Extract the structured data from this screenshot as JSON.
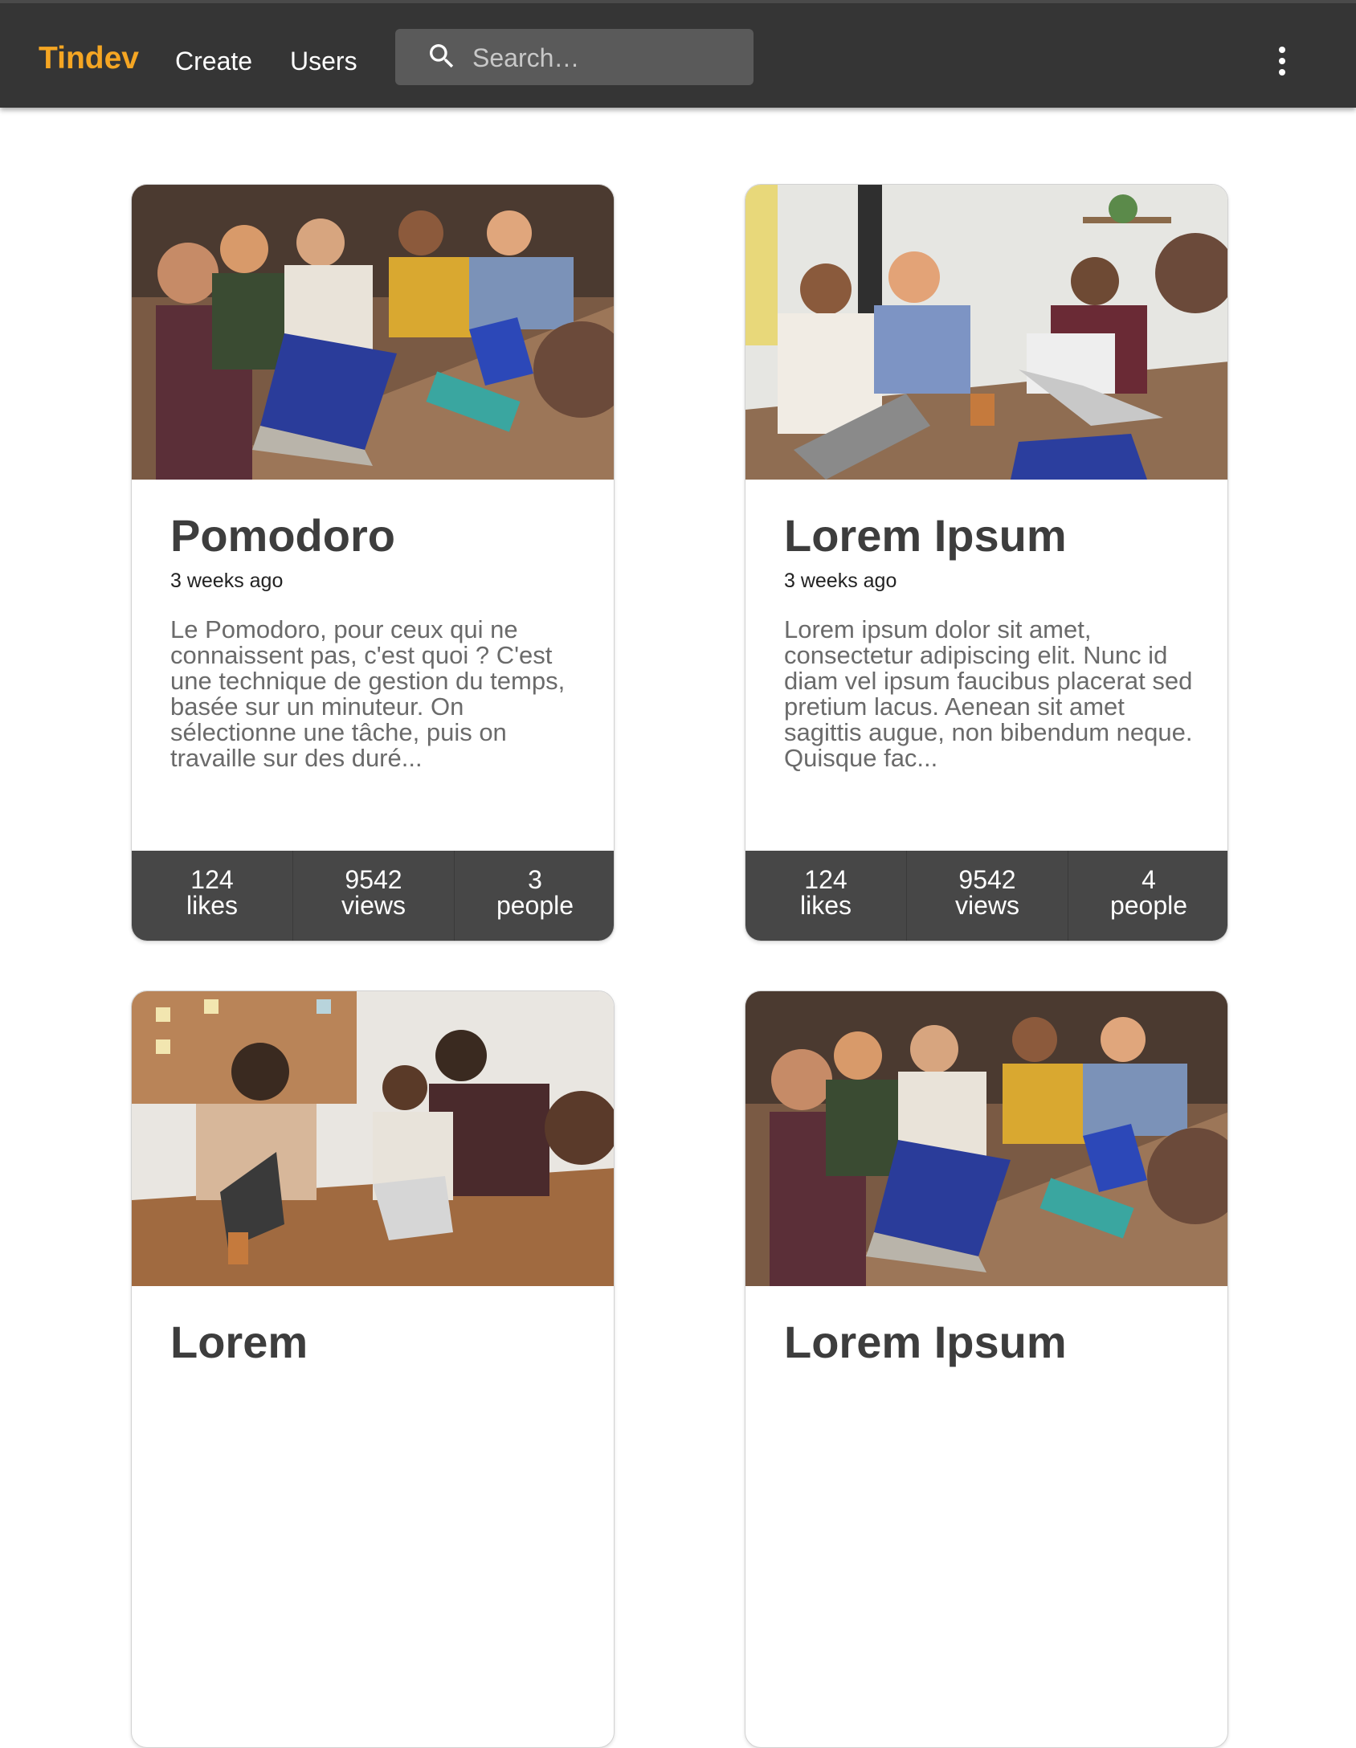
{
  "navbar": {
    "brand": "Tindev",
    "brand_color": "#f5a623",
    "links": [
      "Create",
      "Users"
    ],
    "search_placeholder": "Search…",
    "menu_icon": "more-vert-icon",
    "search_icon": "search-icon"
  },
  "cards": [
    {
      "title": "Pomodoro",
      "date": "3 weeks ago",
      "description": "Le Pomodoro, pour ceux qui ne connaissent pas, c'est quoi ? C'est une technique de gestion du temps, basée sur un minuteur. On sélectionne une tâche, puis on travaille sur des duré...",
      "stats": [
        {
          "value": "124",
          "label": "likes"
        },
        {
          "value": "9542",
          "label": "views"
        },
        {
          "value": "3",
          "label": "people"
        }
      ]
    },
    {
      "title": "Lorem Ipsum",
      "date": "3 weeks ago",
      "description": "Lorem ipsum dolor sit amet, consectetur adipiscing elit. Nunc id diam vel ipsum faucibus placerat sed pretium lacus. Aenean sit amet sagittis augue, non bibendum neque. Quisque fac...",
      "stats": [
        {
          "value": "124",
          "label": "likes"
        },
        {
          "value": "9542",
          "label": "views"
        },
        {
          "value": "4",
          "label": "people"
        }
      ]
    },
    {
      "title": "Lorem",
      "date": "",
      "description": ""
    },
    {
      "title": "Lorem Ipsum",
      "date": "",
      "description": ""
    }
  ]
}
